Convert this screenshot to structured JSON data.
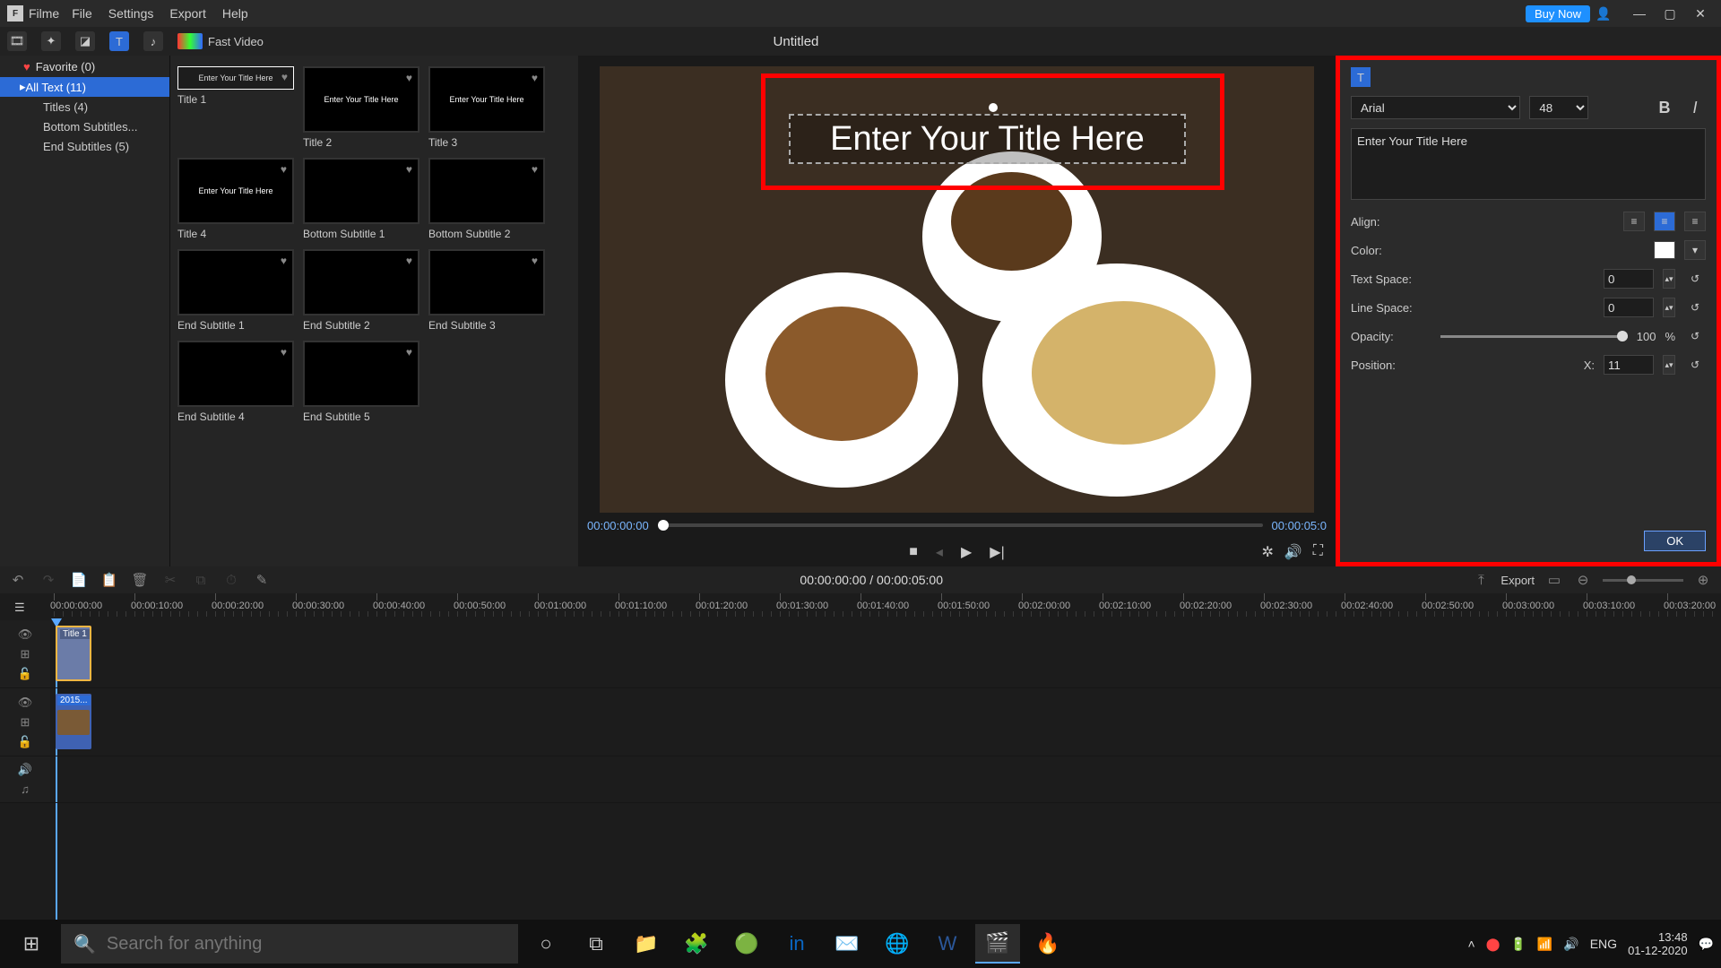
{
  "app": {
    "name": "Filme",
    "buy_now": "Buy Now"
  },
  "menu": {
    "file": "File",
    "settings": "Settings",
    "export": "Export",
    "help": "Help"
  },
  "toolbar": {
    "fast_video": "Fast Video",
    "project_title": "Untitled"
  },
  "sidebar": {
    "favorite": "Favorite (0)",
    "all_text": "All Text (11)",
    "titles": "Titles (4)",
    "bottom_subtitles": "Bottom Subtitles...",
    "end_subtitles": "End Subtitles (5)"
  },
  "thumbs": [
    {
      "label": "Title 1",
      "text": "Enter Your Title Here",
      "sel": true
    },
    {
      "label": "Title 2",
      "text": "Enter Your Title Here"
    },
    {
      "label": "Title 3",
      "text": "Enter Your Title Here"
    },
    {
      "label": "Title 4",
      "text": "Enter Your Title Here"
    },
    {
      "label": "Bottom Subtitle 1",
      "text": ""
    },
    {
      "label": "Bottom Subtitle 2",
      "text": ""
    },
    {
      "label": "End Subtitle 1",
      "text": ""
    },
    {
      "label": "End Subtitle 2",
      "text": ""
    },
    {
      "label": "End Subtitle 3",
      "text": ""
    },
    {
      "label": "End Subtitle 4",
      "text": ""
    },
    {
      "label": "End Subtitle 5",
      "text": ""
    }
  ],
  "preview": {
    "title_text": "Enter Your Title Here",
    "current_time": "00:00:00:00",
    "duration": "00:00:05:0"
  },
  "props": {
    "font": "Arial",
    "font_size": "48",
    "text_value": "Enter Your Title Here",
    "align_label": "Align:",
    "color_label": "Color:",
    "text_space_label": "Text Space:",
    "text_space_val": "0",
    "line_space_label": "Line Space:",
    "line_space_val": "0",
    "opacity_label": "Opacity:",
    "opacity_val": "100",
    "opacity_pct": "%",
    "position_label": "Position:",
    "pos_x_label": "X:",
    "pos_x_val": "11",
    "ok": "OK"
  },
  "timeline": {
    "current": "00:00:00:00",
    "sep": " / ",
    "total": "00:00:05:00",
    "export": "Export",
    "ticks": [
      "00:00:00:00",
      "00:00:10:00",
      "00:00:20:00",
      "00:00:30:00",
      "00:00:40:00",
      "00:00:50:00",
      "00:01:00:00",
      "00:01:10:00",
      "00:01:20:00",
      "00:01:30:00",
      "00:01:40:00",
      "00:01:50:00",
      "00:02:00:00",
      "00:02:10:00",
      "00:02:20:00",
      "00:02:30:00",
      "00:02:40:00",
      "00:02:50:00",
      "00:03:00:00",
      "00:03:10:00",
      "00:03:20:00"
    ],
    "title_clip": "Title 1",
    "video_clip": "2015..."
  },
  "taskbar": {
    "search_placeholder": "Search for anything",
    "lang": "ENG",
    "time": "13:48",
    "date": "01-12-2020"
  }
}
